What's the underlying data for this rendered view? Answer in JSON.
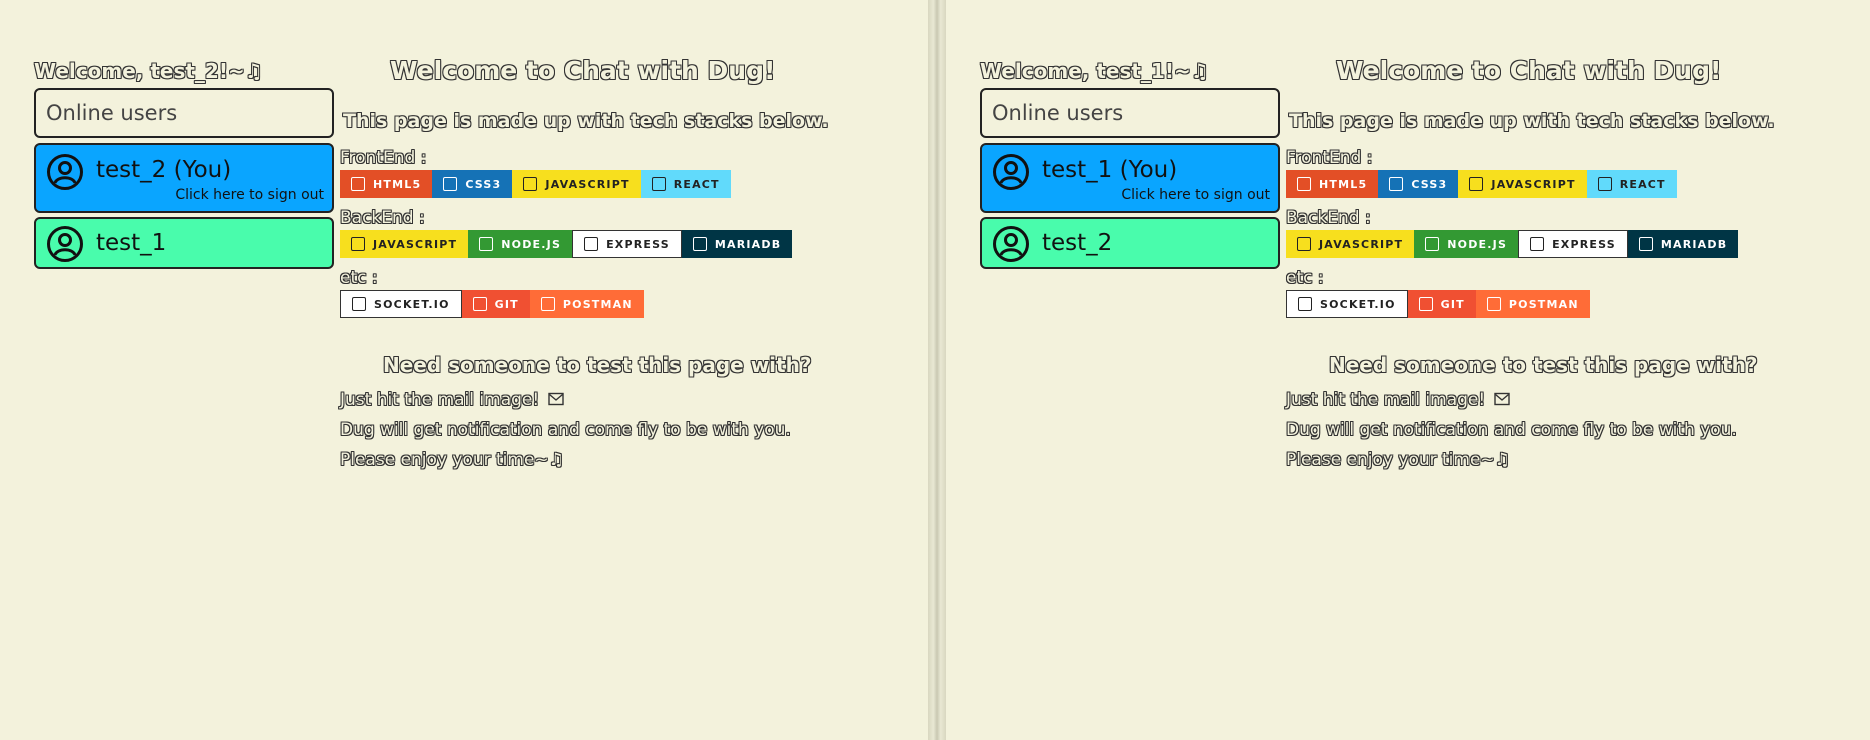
{
  "colors": {
    "background": "#f3f2dc",
    "self_card": "#0aa5ff",
    "other_card": "#49fcac"
  },
  "panes": [
    {
      "welcome_user": "Welcome, test_2!~♫",
      "online_users_label": "Online users",
      "self_user": {
        "name": "test_2 (You)",
        "sign_out": "Click here to sign out",
        "icon": "user-circle-icon"
      },
      "other_user": {
        "name": "test_1",
        "icon": "user-circle-icon"
      }
    },
    {
      "welcome_user": "Welcome, test_1!~♫",
      "online_users_label": "Online users",
      "self_user": {
        "name": "test_1 (You)",
        "sign_out": "Click here to sign out",
        "icon": "user-circle-icon"
      },
      "other_user": {
        "name": "test_2",
        "icon": "user-circle-icon"
      }
    }
  ],
  "main": {
    "title": "Welcome to Chat with Dug!",
    "stack_intro": "This page is made up with tech stacks below.",
    "frontend_label": "FrontEnd :",
    "backend_label": "BackEnd :",
    "etc_label": "etc :",
    "frontend_badges": [
      {
        "label": "HTML5",
        "icon": "html5-icon",
        "bg": "#e34f26",
        "fg": "#ffffff"
      },
      {
        "label": "CSS3",
        "icon": "css3-icon",
        "bg": "#1572b6",
        "fg": "#ffffff"
      },
      {
        "label": "JAVASCRIPT",
        "icon": "javascript-icon",
        "bg": "#f7df1e",
        "fg": "#222222"
      },
      {
        "label": "REACT",
        "icon": "react-icon",
        "bg": "#61dafb",
        "fg": "#222222"
      }
    ],
    "backend_badges": [
      {
        "label": "JAVASCRIPT",
        "icon": "javascript-icon",
        "bg": "#f7df1e",
        "fg": "#222222"
      },
      {
        "label": "NODE.JS",
        "icon": "nodejs-icon",
        "bg": "#339933",
        "fg": "#ffffff"
      },
      {
        "label": "EXPRESS",
        "icon": "express-icon",
        "bg": "#ffffff",
        "fg": "#222222"
      },
      {
        "label": "MARIADB",
        "icon": "mariadb-icon",
        "bg": "#003545",
        "fg": "#ffffff"
      }
    ],
    "etc_badges": [
      {
        "label": "SOCKET.IO",
        "icon": "socketio-icon",
        "bg": "#ffffff",
        "fg": "#222222"
      },
      {
        "label": "GIT",
        "icon": "git-icon",
        "bg": "#f05032",
        "fg": "#ffffff"
      },
      {
        "label": "POSTMAN",
        "icon": "postman-icon",
        "bg": "#ff6c37",
        "fg": "#ffffff"
      }
    ],
    "need_title": "Need someone to test this page with?",
    "line1": "Just hit the mail image!",
    "line1_icon": "mail-icon",
    "line2": "Dug will get notification and come fly to be with you.",
    "line3": "Please enjoy your time~♫"
  }
}
